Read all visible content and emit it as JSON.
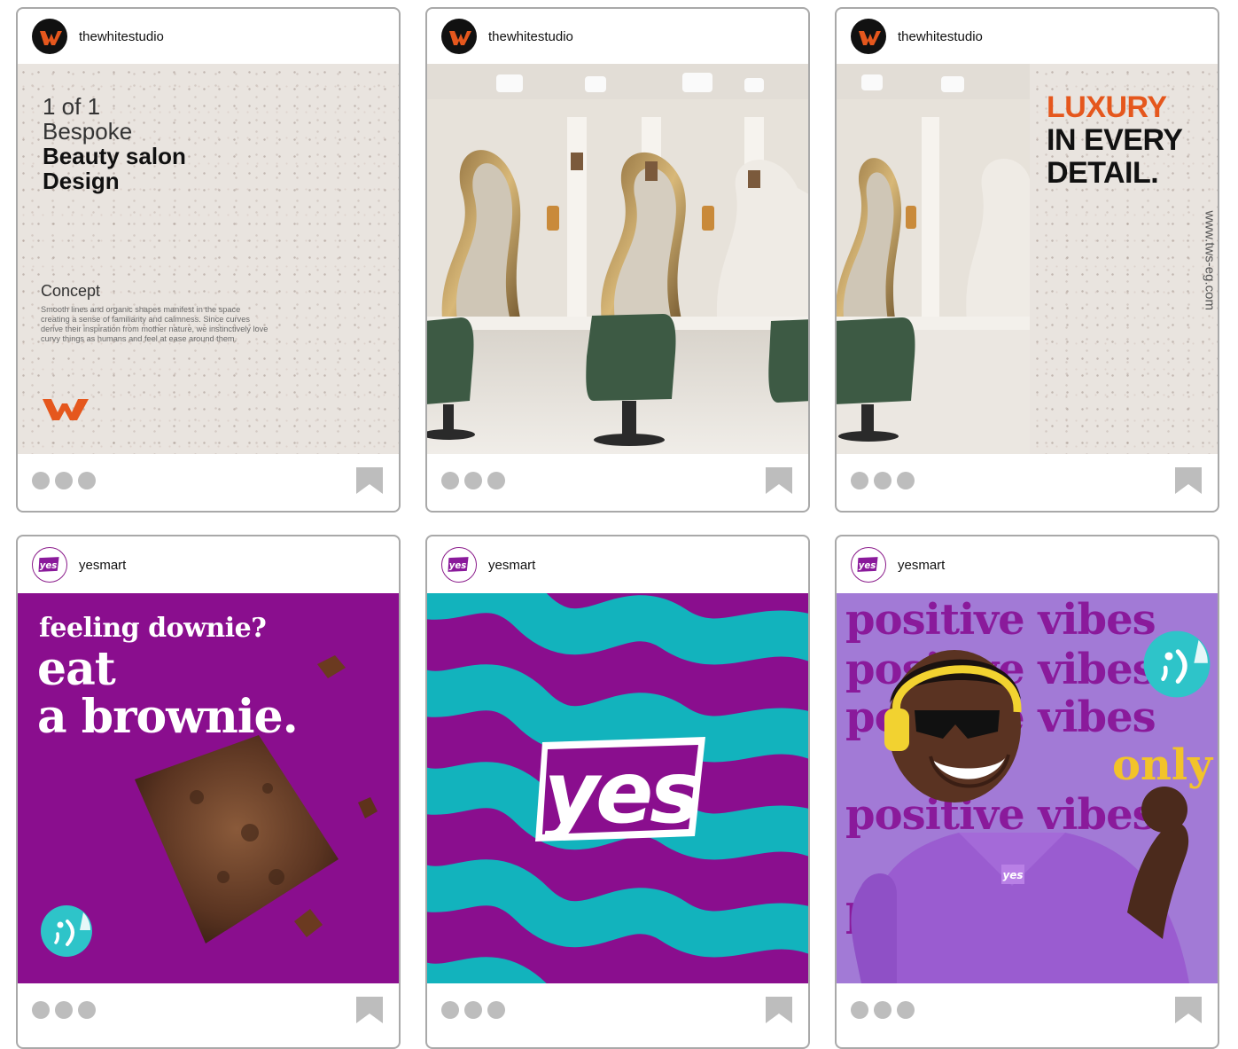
{
  "cards": [
    {
      "username": "thewhitestudio",
      "avatar_icon": "thewhitestudio-logo-icon",
      "post": {
        "line1": "1 of 1",
        "line2": "Bespoke",
        "line3": "Beauty salon",
        "line4": "Design",
        "concept_title": "Concept",
        "concept_body": "Smooth lines and organic shapes manifest in the space creating a sense of familiarity and calmness. Since curves derive their inspiration from mother nature, we instinctively love curvy things as humans and feel at ease around them."
      }
    },
    {
      "username": "thewhitestudio",
      "avatar_icon": "thewhitestudio-logo-icon"
    },
    {
      "username": "thewhitestudio",
      "avatar_icon": "thewhitestudio-logo-icon",
      "post": {
        "luxury": "LUXURY",
        "line2": "IN EVERY",
        "line3": "DETAIL.",
        "url": "www.tws-eg.com"
      }
    },
    {
      "username": "yesmart",
      "avatar_icon": "yesmart-logo-icon",
      "post": {
        "line1": "feeling downie?",
        "line2": "eat",
        "line3": "a brownie."
      }
    },
    {
      "username": "yesmart",
      "avatar_icon": "yesmart-logo-icon",
      "post": {
        "logo_text": "yes"
      }
    },
    {
      "username": "yesmart",
      "avatar_icon": "yesmart-logo-icon",
      "post": {
        "vibes": "positive vibes",
        "only": "only",
        "hoodie_logo": "yes"
      }
    }
  ],
  "colors": {
    "tws_orange": "#e5571d",
    "yes_purple": "#8a0e8e",
    "yes_teal": "#12b3bd",
    "yes_yellow": "#f2c32a"
  },
  "icons": {
    "more": "three-dots-icon",
    "save": "bookmark-icon",
    "sticker": "winking-face-sticker-icon"
  }
}
